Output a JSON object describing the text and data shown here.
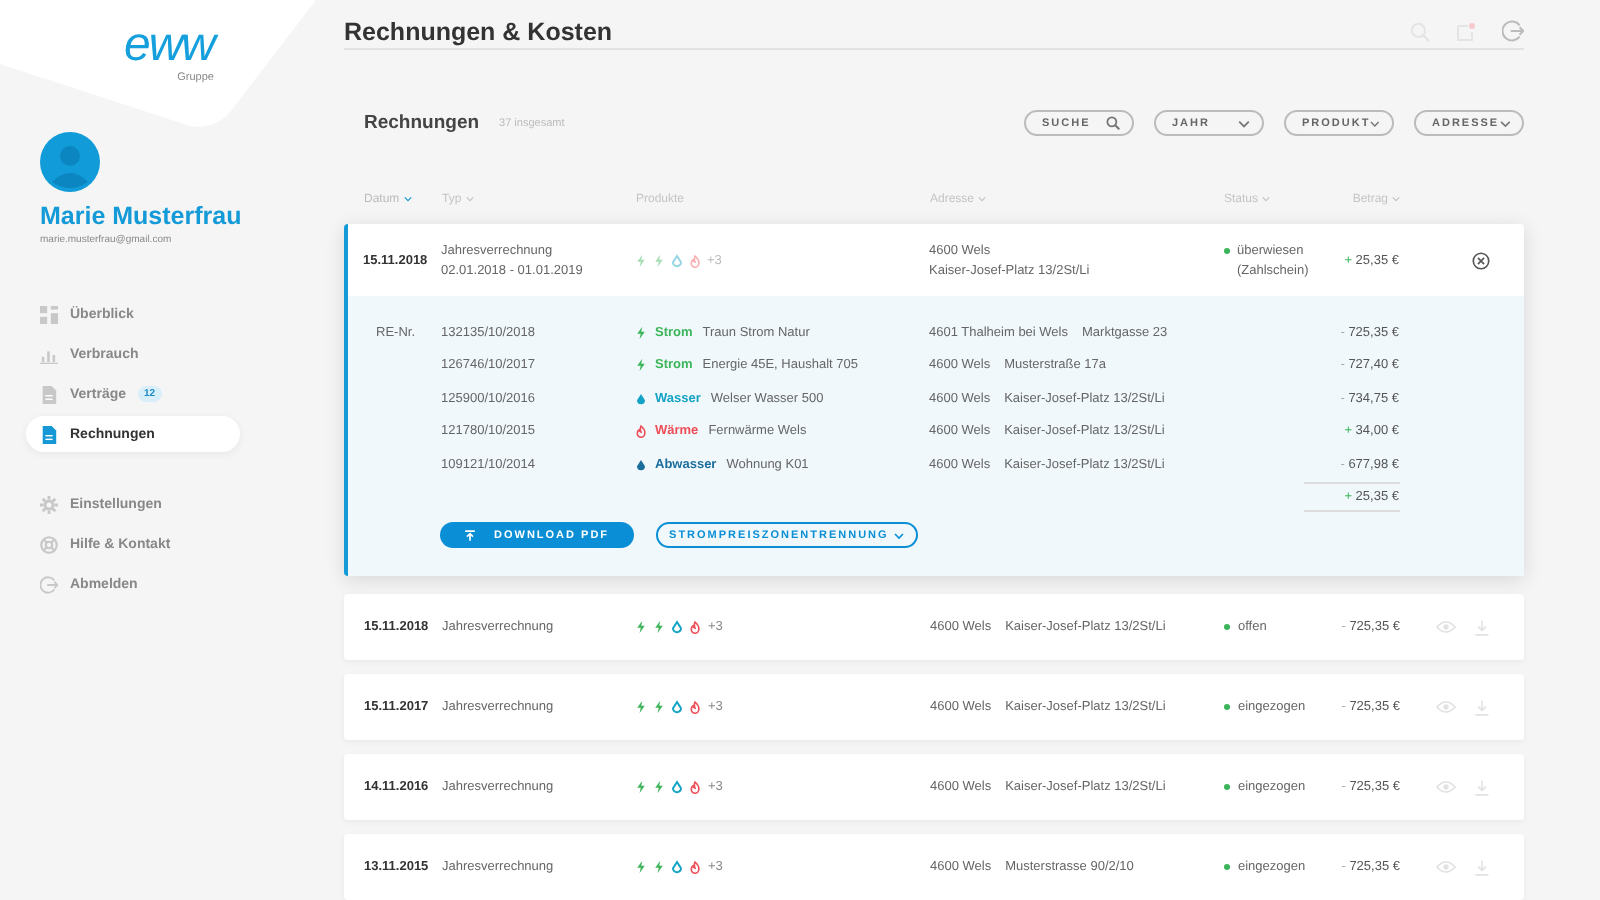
{
  "logo": {
    "mark": "eww",
    "subtitle": "Gruppe"
  },
  "user": {
    "name": "Marie Musterfrau",
    "email": "marie.musterfrau@gmail.com"
  },
  "nav": [
    {
      "label": "Überblick",
      "selected": false
    },
    {
      "label": "Verbrauch",
      "selected": false
    },
    {
      "label": "Verträge",
      "selected": false,
      "badge": "12"
    },
    {
      "label": "Rechnungen",
      "selected": true
    }
  ],
  "nav_secondary": [
    {
      "label": "Einstellungen",
      "selected": false
    },
    {
      "label": "Hilfe & Kontakt",
      "selected": false
    },
    {
      "label": "Abmelden",
      "selected": false
    }
  ],
  "page_title": "Rechnungen & Kosten",
  "section": {
    "title": "Rechnungen",
    "count": "37 insgesamt"
  },
  "filters": [
    {
      "label": "SUCHE",
      "kind": "search"
    },
    {
      "label": "JAHR",
      "kind": "select"
    },
    {
      "label": "PRODUKT",
      "kind": "select"
    },
    {
      "label": "ADRESSE",
      "kind": "select"
    }
  ],
  "columns": [
    {
      "label": "Datum",
      "sortable": true,
      "selected": true
    },
    {
      "label": "Typ",
      "sortable": true,
      "selected": false
    },
    {
      "label": "Produkte",
      "sortable": false,
      "selected": false
    },
    {
      "label": "Adresse",
      "sortable": true,
      "selected": false
    },
    {
      "label": "Status",
      "sortable": true,
      "selected": false
    },
    {
      "label": "Betrag",
      "sortable": true,
      "selected": false
    }
  ],
  "invoices": [
    {
      "date": "15.11.2018",
      "type": "Jahresverrechnung",
      "period": "02.01.2018 - 01.01.2019",
      "products": [
        {
          "kind": "strom"
        },
        {
          "kind": "strom"
        },
        {
          "kind": "wasser"
        },
        {
          "kind": "waerme"
        }
      ],
      "more": "+3",
      "city": "4600 Wels",
      "street": "Kaiser-Josef-Platz 13/2St/Li",
      "status": "überwiesen",
      "status_note": "(Zahlschein)",
      "sign": "+",
      "value": "25,35 €",
      "credit": true,
      "expanded": true,
      "details": {
        "label": "RE-Nr.",
        "items": [
          {
            "number": "132135/10/2018",
            "kind": "strom",
            "product": "Strom",
            "tariff": "Traun Strom Natur",
            "city": "4601 Thalheim bei Wels",
            "street": "Marktgasse 23",
            "sign": "-",
            "value": "725,35 €",
            "credit": false
          },
          {
            "number": "126746/10/2017",
            "kind": "strom",
            "product": "Strom",
            "tariff": "Energie 45E, Haushalt 705",
            "city": "4600 Wels",
            "street": "Musterstraße 17a",
            "sign": "-",
            "value": "727,40 €",
            "credit": false
          },
          {
            "number": "125900/10/2016",
            "kind": "wasser",
            "product": "Wasser",
            "tariff": "Welser Wasser 500",
            "city": "4600 Wels",
            "street": "Kaiser-Josef-Platz 13/2St/Li",
            "sign": "-",
            "value": "734,75 €",
            "credit": false
          },
          {
            "number": "121780/10/2015",
            "kind": "waerme",
            "product": "Wärme",
            "tariff": "Fernwärme Wels",
            "city": "4600 Wels",
            "street": "Kaiser-Josef-Platz 13/2St/Li",
            "sign": "+",
            "value": "34,00 €",
            "credit": true
          },
          {
            "number": "109121/10/2014",
            "kind": "abwasser",
            "product": "Abwasser",
            "tariff": "Wohnung K01",
            "city": "4600 Wels",
            "street": "Kaiser-Josef-Platz 13/2St/Li",
            "sign": "-",
            "value": "677,98 €",
            "credit": false
          }
        ],
        "total": {
          "sign": "+",
          "value": "25,35 €",
          "credit": true
        },
        "download": "DOWNLOAD PDF",
        "toggle": "STROMPREISZONENTRENNUNG"
      }
    },
    {
      "date": "15.11.2018",
      "type": "Jahresverrechnung",
      "products": [
        {
          "kind": "strom"
        },
        {
          "kind": "strom"
        },
        {
          "kind": "wasser"
        },
        {
          "kind": "waerme"
        }
      ],
      "more": "+3",
      "city": "4600 Wels",
      "street": "Kaiser-Josef-Platz 13/2St/Li",
      "status": "offen",
      "sign": "-",
      "value": "725,35 €",
      "credit": false,
      "expanded": false
    },
    {
      "date": "15.11.2017",
      "type": "Jahresverrechnung",
      "products": [
        {
          "kind": "strom"
        },
        {
          "kind": "strom"
        },
        {
          "kind": "wasser"
        },
        {
          "kind": "waerme"
        }
      ],
      "more": "+3",
      "city": "4600 Wels",
      "street": "Kaiser-Josef-Platz 13/2St/Li",
      "status": "eingezogen",
      "sign": "-",
      "value": "725,35 €",
      "credit": false,
      "expanded": false
    },
    {
      "date": "14.11.2016",
      "type": "Jahresverrechnung",
      "products": [
        {
          "kind": "strom"
        },
        {
          "kind": "strom"
        },
        {
          "kind": "wasser"
        },
        {
          "kind": "waerme"
        }
      ],
      "more": "+3",
      "city": "4600 Wels",
      "street": "Kaiser-Josef-Platz 13/2St/Li",
      "status": "eingezogen",
      "sign": "-",
      "value": "725,35 €",
      "credit": false,
      "expanded": false
    },
    {
      "date": "13.11.2015",
      "type": "Jahresverrechnung",
      "products": [
        {
          "kind": "strom"
        },
        {
          "kind": "strom"
        },
        {
          "kind": "wasser"
        },
        {
          "kind": "waerme"
        }
      ],
      "more": "+3",
      "city": "4600 Wels",
      "street": "Musterstrasse 90/2/10",
      "status": "eingezogen",
      "sign": "-",
      "value": "725,35 €",
      "credit": false,
      "expanded": false
    }
  ]
}
